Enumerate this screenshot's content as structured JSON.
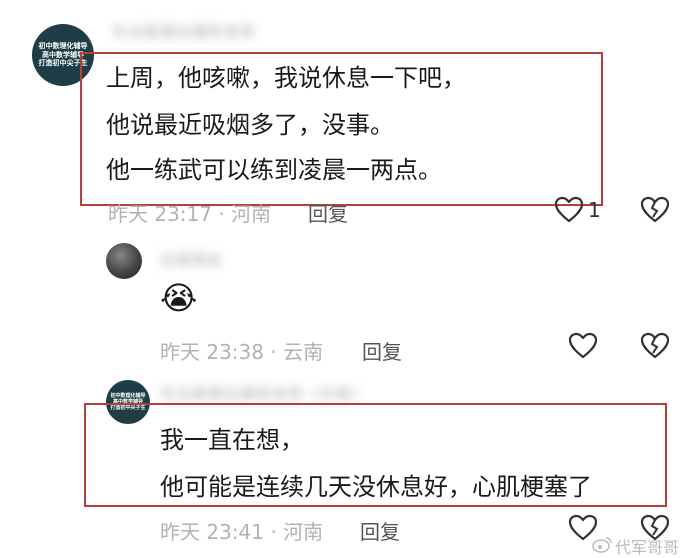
{
  "comments": [
    {
      "avatar_lines": [
        "初中数理化辅导",
        "高中数学辅导",
        "打造初中尖子生"
      ],
      "username": "专业数理化辅导老师",
      "lines": [
        "上周，他咳嗽，我说休息一下吧，",
        "他说最近吸烟多了，没事。",
        "他一练武可以练到凌晨一两点。"
      ],
      "time": "昨天 23:17",
      "location": "· 河南",
      "reply": "回复",
      "likes": "1"
    },
    {
      "username": "云南网友",
      "emoji": "😭",
      "time": "昨天 23:38",
      "location": "· 云南",
      "reply": "回复"
    },
    {
      "avatar_lines": [
        "初中数理化辅导",
        "高中数学辅导",
        "打造初中尖子生"
      ],
      "username": "专业数理化辅导老师（作者）",
      "lines": [
        "我一直在想，",
        "他可能是连续几天没休息好，心肌梗塞了"
      ],
      "time": "昨天 23:41",
      "location": "· 河南",
      "reply": "回复"
    }
  ],
  "watermark": "代军哥哥",
  "icons": {
    "like": "heart-outline-icon",
    "dislike": "broken-heart-icon",
    "weibo": "weibo-logo-icon"
  },
  "colors": {
    "highlight_box": "#b5403a",
    "avatar_bg": "#1f3d47",
    "meta_text": "#b2b2b2"
  }
}
